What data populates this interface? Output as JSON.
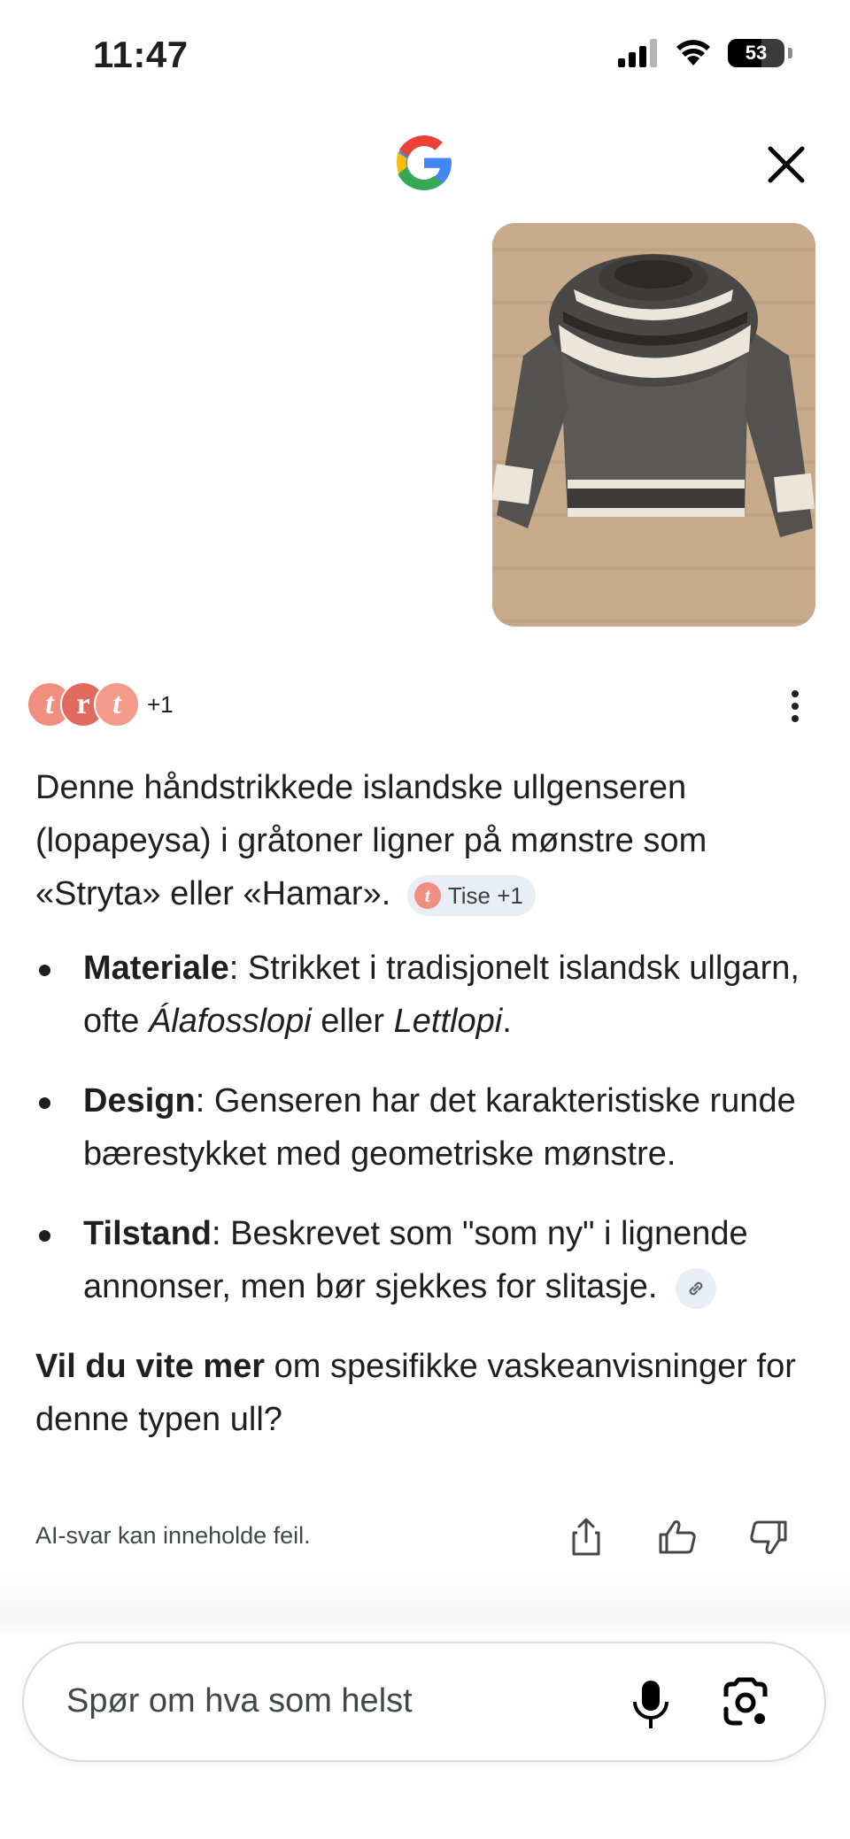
{
  "status_bar": {
    "time": "11:47",
    "battery": "53"
  },
  "header": {
    "logo_icon": "google-g-icon",
    "close_icon": "close-icon"
  },
  "image": {
    "subject": "sweater-photo",
    "colors": [
      "#5b5956",
      "#ece6da",
      "#2b2a28"
    ]
  },
  "sources": {
    "more_count": "+1",
    "avatar_letters": [
      "t",
      "r",
      "t"
    ]
  },
  "answer": {
    "intro": "Denne håndstrikkede islandske ullgenseren (lopapeysa) i gråtoner ligner på mønstre som «Stryta» eller «Hamar».",
    "intro_chip": "Tise +1",
    "bullets": [
      {
        "term": "Materiale",
        "text_a": ": Strikket i tradisjonelt islandsk ullgarn, ofte ",
        "italic_a": "Álafosslopi",
        "text_b": " eller ",
        "italic_b": "Lettlopi",
        "text_c": "."
      },
      {
        "term": "Design",
        "text": ": Genseren har det karakteristiske runde bærestykket med geometriske mønstre."
      },
      {
        "term": "Tilstand",
        "text": ": Beskrevet som \"som ny\" i lignende annonser, men bør sjekkes for slitasje."
      }
    ],
    "followup_bold": "Vil du vite mer",
    "followup_rest": " om spesifikke vaskeanvisninger for denne typen ull?"
  },
  "footer": {
    "disclaimer": "AI-svar kan inneholde feil."
  },
  "input": {
    "placeholder": "Spør om hva som helst"
  },
  "colors": {
    "chip_bg": "#e9eef6",
    "avatar": "#f08e7f"
  }
}
